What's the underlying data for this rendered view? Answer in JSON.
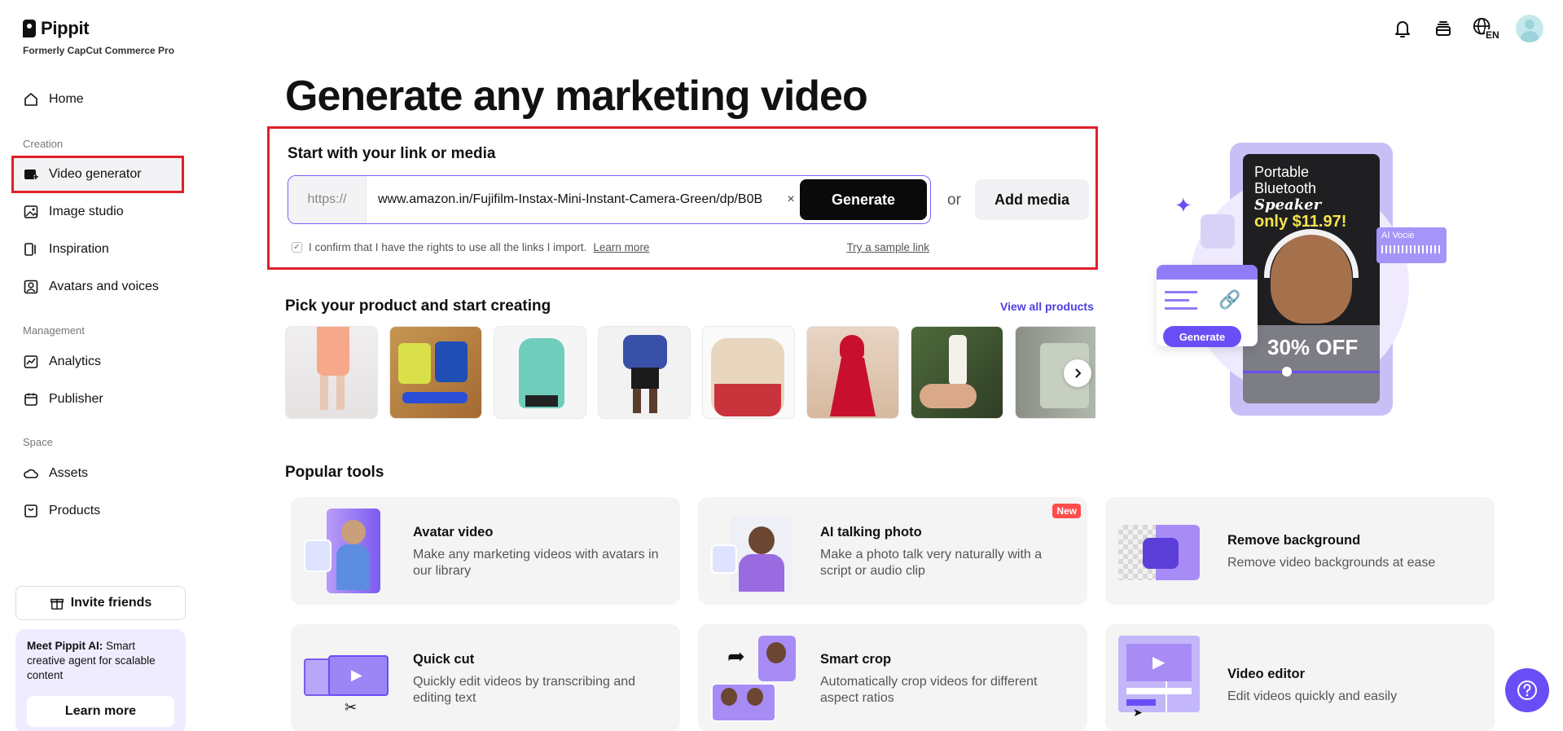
{
  "brand": {
    "name": "Pippit",
    "subtitle": "Formerly CapCut Commerce Pro"
  },
  "sidebar": {
    "home": "Home",
    "sections": {
      "creation": "Creation",
      "management": "Management",
      "space": "Space"
    },
    "items": {
      "video_generator": "Video generator",
      "image_studio": "Image studio",
      "inspiration": "Inspiration",
      "avatars_voices": "Avatars and voices",
      "analytics": "Analytics",
      "publisher": "Publisher",
      "assets": "Assets",
      "products": "Products"
    },
    "invite": "Invite friends",
    "promo": {
      "bold": "Meet Pippit AI:",
      "text": " Smart creative agent for scalable content",
      "button": "Learn more"
    }
  },
  "header": {
    "language": "EN"
  },
  "main": {
    "title": "Generate any marketing video",
    "link_section": {
      "title": "Start with your link or media",
      "prefix": "https://",
      "url": "www.amazon.in/Fujifilm-Instax-Mini-Instant-Camera-Green/dp/B0B",
      "clear": "×",
      "generate": "Generate",
      "or": "or",
      "add_media": "Add media",
      "confirm": "I confirm that I have the rights to use all the links I import.",
      "learn_more": "Learn more",
      "sample": "Try a sample link"
    },
    "products": {
      "title": "Pick your product and start creating",
      "view_all": "View all products"
    },
    "promo_card": {
      "line1": "Portable",
      "line2": "Bluetooth",
      "line2_italic": "Speaker",
      "price": "only $11.97!",
      "ai_voice": "AI Vocie",
      "generate": "Generate",
      "discount": "30% OFF"
    },
    "popular": {
      "title": "Popular tools",
      "tools": [
        {
          "title": "Avatar video",
          "desc": "Make any marketing videos with avatars in our library"
        },
        {
          "title": "AI talking photo",
          "desc": "Make a photo talk very naturally with a script or audio clip",
          "badge": "New"
        },
        {
          "title": "Remove background",
          "desc": "Remove video backgrounds at ease"
        },
        {
          "title": "Quick cut",
          "desc": "Quickly edit videos by transcribing and editing text"
        },
        {
          "title": "Smart crop",
          "desc": "Automatically crop videos for different aspect ratios"
        },
        {
          "title": "Video editor",
          "desc": "Edit videos quickly and easily"
        }
      ]
    }
  },
  "colors": {
    "accent": "#6a4ef5",
    "highlight": "#e0202a",
    "link": "#4c3fe0"
  }
}
